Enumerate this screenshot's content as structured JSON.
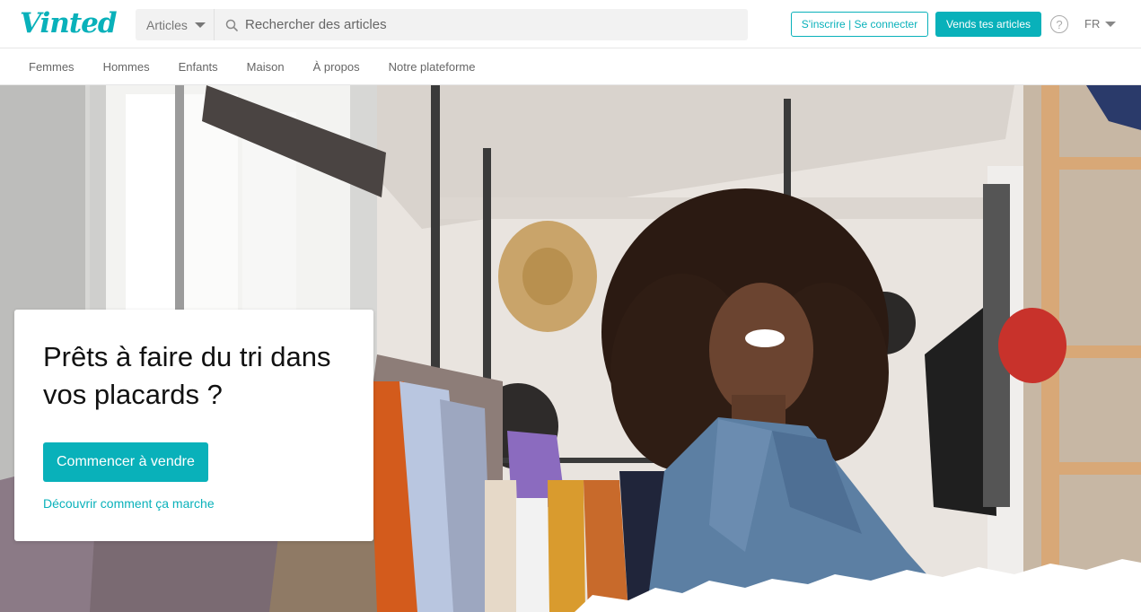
{
  "header": {
    "logo": "Vinted",
    "category_select": "Articles",
    "search_placeholder": "Rechercher des articles",
    "login_label": "S'inscrire | Se connecter",
    "sell_label": "Vends tes articles",
    "help_symbol": "?",
    "language": "FR"
  },
  "nav": {
    "items": [
      "Femmes",
      "Hommes",
      "Enfants",
      "Maison",
      "À propos",
      "Notre plateforme"
    ]
  },
  "hero": {
    "title": "Prêts à faire du tri dans vos placards ?",
    "cta_label": "Commencer à vendre",
    "link_label": "Découvrir comment ça marche"
  },
  "colors": {
    "brand": "#09b1ba",
    "text": "#111111",
    "muted": "#777777"
  },
  "icons": {
    "search": "search-icon",
    "help": "help-icon",
    "dropdown": "chevron-down-icon"
  }
}
